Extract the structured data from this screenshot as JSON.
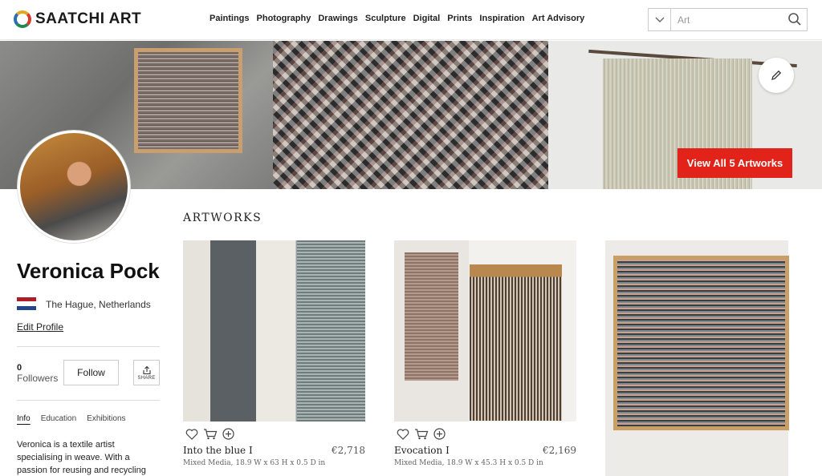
{
  "header": {
    "logo_text": "SAATCHI ART",
    "nav": [
      "Paintings",
      "Photography",
      "Drawings",
      "Sculpture",
      "Digital",
      "Prints",
      "Inspiration",
      "Art Advisory"
    ],
    "search": {
      "placeholder": "Art",
      "value": ""
    }
  },
  "banner": {
    "view_all_label": "View All 5 Artworks"
  },
  "profile": {
    "name": "Veronica Pock",
    "location": "The Hague, Netherlands",
    "flag_colors": [
      "#ae1c28",
      "#ffffff",
      "#21468b"
    ],
    "edit_profile_label": "Edit Profile",
    "followers_count": "0",
    "followers_label": "Followers",
    "follow_label": "Follow",
    "share_label": "SHARE",
    "tabs": [
      "Info",
      "Education",
      "Exhibitions"
    ],
    "active_tab": "Info",
    "bio": "Veronica is a textile artist specialising in weave. With a passion for reusing and recycling"
  },
  "artworks": {
    "section_title": "ARTWORKS",
    "items": [
      {
        "title": "Into the blue I",
        "price": "€2,718",
        "details": "Mixed Media, 18.9 W x 63 H x 0.5 D in"
      },
      {
        "title": "Evocation I",
        "price": "€2,169",
        "details": "Mixed Media, 18.9 W x 45.3 H x 0.5 D in"
      },
      {
        "title": "",
        "price": "",
        "details": ""
      }
    ]
  },
  "colors": {
    "accent_red": "#e2231a"
  },
  "icons": [
    "chevron-down-icon",
    "search-icon",
    "pencil-icon",
    "share-icon",
    "heart-icon",
    "cart-icon",
    "plus-circle-icon"
  ]
}
